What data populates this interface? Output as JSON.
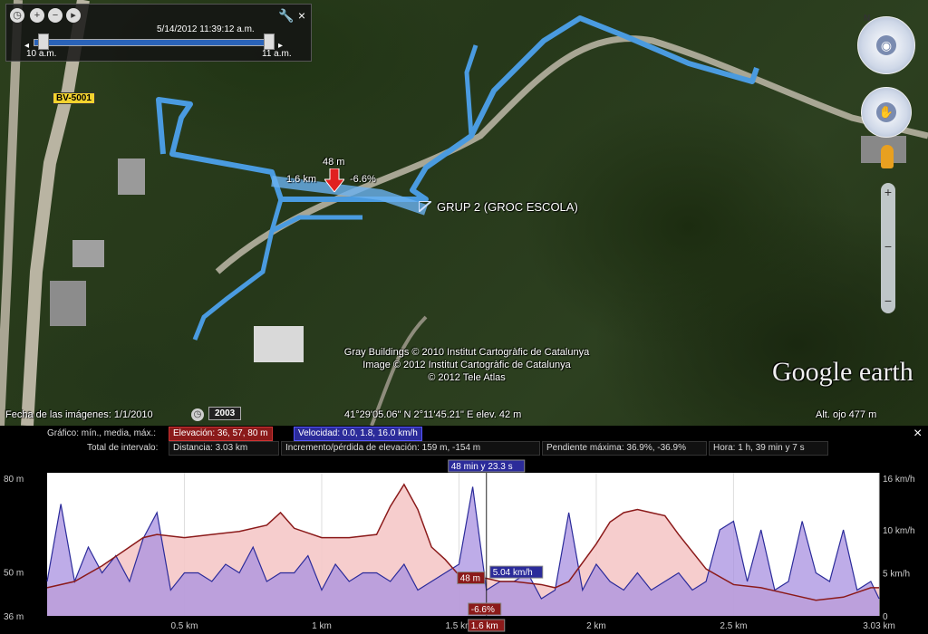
{
  "colors": {
    "track": "#4a9be0",
    "elev_line": "#8b1a1a",
    "elev_fill": "#f5c8c8",
    "speed_line": "#2b2b9a",
    "speed_fill": "#a890e0",
    "panel_bg": "#000000",
    "marker": "#e02020"
  },
  "time_slider": {
    "icons": [
      "clock-icon",
      "zoom-in-icon",
      "zoom-out-icon",
      "play-icon",
      "wrench-icon",
      "close-icon"
    ],
    "datetime": "5/14/2012 11:39:12 a.m.",
    "start_label": "10 a.m.",
    "end_label": "11 a.m."
  },
  "map": {
    "road_label": "BV-5001",
    "placemark_label": "GRUP 2 (GROC ESCOLA)",
    "cursor": {
      "elevation": "48 m",
      "distance": "1.6 km",
      "slope": "-6.6%"
    },
    "attribution": [
      "Gray Buildings © 2010 Institut Cartogràfic de Catalunya",
      "Image © 2012 Institut Cartogràfic de Catalunya",
      "© 2012 Tele Atlas"
    ],
    "logo": "Google earth",
    "status": {
      "imagery_date": "Fecha de las imágenes: 1/1/2010",
      "history_year": "2003",
      "coords": "41°29'05.06\" N   2°11'45.21\" E  elev.   42 m",
      "eye_alt": "Alt. ojo    477 m"
    }
  },
  "profile": {
    "close": "×",
    "chart_label": "Gráfico: mín., media, máx.:",
    "elevation_stat": "Elevación: 36, 57, 80 m",
    "speed_stat": "Velocidad: 0.0, 1.8, 16.0 km/h",
    "range_label": "Total de intervalo:",
    "distance_stat": "Distancia: 3.03 km",
    "gain_stat": "Incremento/pérdida de elevación: 159 m, -154 m",
    "slope_stat": "Pendiente máxima: 36.9%, -36.9%",
    "time_stat": "Hora: 1 h, 39 min y 7 s",
    "cursor_time": "48 min y 23.3 s",
    "cursor_elev": "48 m",
    "cursor_speed": "5.04 km/h",
    "cursor_slope": "-6.6%",
    "cursor_dist": "1.6 km"
  },
  "chart_data": {
    "type": "area",
    "x_range": [
      0,
      3.03
    ],
    "xticks": [
      "0.5 km",
      "1 km",
      "1.5 km",
      "2 km",
      "2.5 km",
      "3.03 km"
    ],
    "y_left_ticks": [
      "80 m",
      "50 m",
      "36 m"
    ],
    "y_left_range": [
      36,
      80
    ],
    "y_right_ticks": [
      "16 km/h",
      "10 km/h",
      "5 km/h",
      "0"
    ],
    "y_right_range": [
      0,
      16
    ],
    "series": [
      {
        "name": "Elevación",
        "unit": "m",
        "x": [
          0,
          0.1,
          0.2,
          0.3,
          0.35,
          0.4,
          0.5,
          0.6,
          0.7,
          0.8,
          0.85,
          0.9,
          1.0,
          1.1,
          1.2,
          1.25,
          1.3,
          1.35,
          1.4,
          1.45,
          1.5,
          1.55,
          1.6,
          1.65,
          1.7,
          1.8,
          1.85,
          1.9,
          2.0,
          2.05,
          2.1,
          2.15,
          2.2,
          2.25,
          2.3,
          2.4,
          2.5,
          2.6,
          2.7,
          2.8,
          2.9,
          3.0,
          3.03
        ],
        "values": [
          45,
          47,
          52,
          58,
          61,
          62,
          61,
          62,
          63,
          65,
          69,
          64,
          61,
          61,
          62,
          71,
          78,
          70,
          58,
          54,
          49,
          48,
          48,
          47,
          47,
          46,
          45,
          47,
          59,
          66,
          69,
          70,
          69,
          68,
          62,
          51,
          46,
          45,
          43,
          41,
          42,
          45,
          45
        ]
      },
      {
        "name": "Velocidad",
        "unit": "km/h",
        "x": [
          0,
          0.05,
          0.1,
          0.15,
          0.2,
          0.25,
          0.3,
          0.35,
          0.4,
          0.45,
          0.5,
          0.55,
          0.6,
          0.65,
          0.7,
          0.75,
          0.8,
          0.85,
          0.9,
          0.95,
          1.0,
          1.05,
          1.1,
          1.15,
          1.2,
          1.25,
          1.3,
          1.35,
          1.4,
          1.45,
          1.5,
          1.55,
          1.6,
          1.65,
          1.7,
          1.75,
          1.8,
          1.85,
          1.9,
          1.95,
          2.0,
          2.05,
          2.1,
          2.15,
          2.2,
          2.25,
          2.3,
          2.35,
          2.4,
          2.45,
          2.5,
          2.55,
          2.6,
          2.65,
          2.7,
          2.75,
          2.8,
          2.85,
          2.9,
          2.95,
          3.0,
          3.03
        ],
        "values": [
          4,
          13,
          4,
          8,
          5,
          7,
          4,
          9,
          12,
          3,
          5,
          5,
          4,
          6,
          5,
          8,
          4,
          5,
          5,
          7,
          3,
          6,
          4,
          5,
          5,
          4,
          6,
          3,
          4,
          5,
          6,
          15,
          3,
          4,
          4,
          5,
          2,
          3,
          12,
          3,
          6,
          4,
          3,
          5,
          3,
          4,
          5,
          3,
          4,
          10,
          11,
          4,
          10,
          3,
          4,
          11,
          5,
          4,
          10,
          3,
          4,
          2
        ]
      }
    ]
  }
}
